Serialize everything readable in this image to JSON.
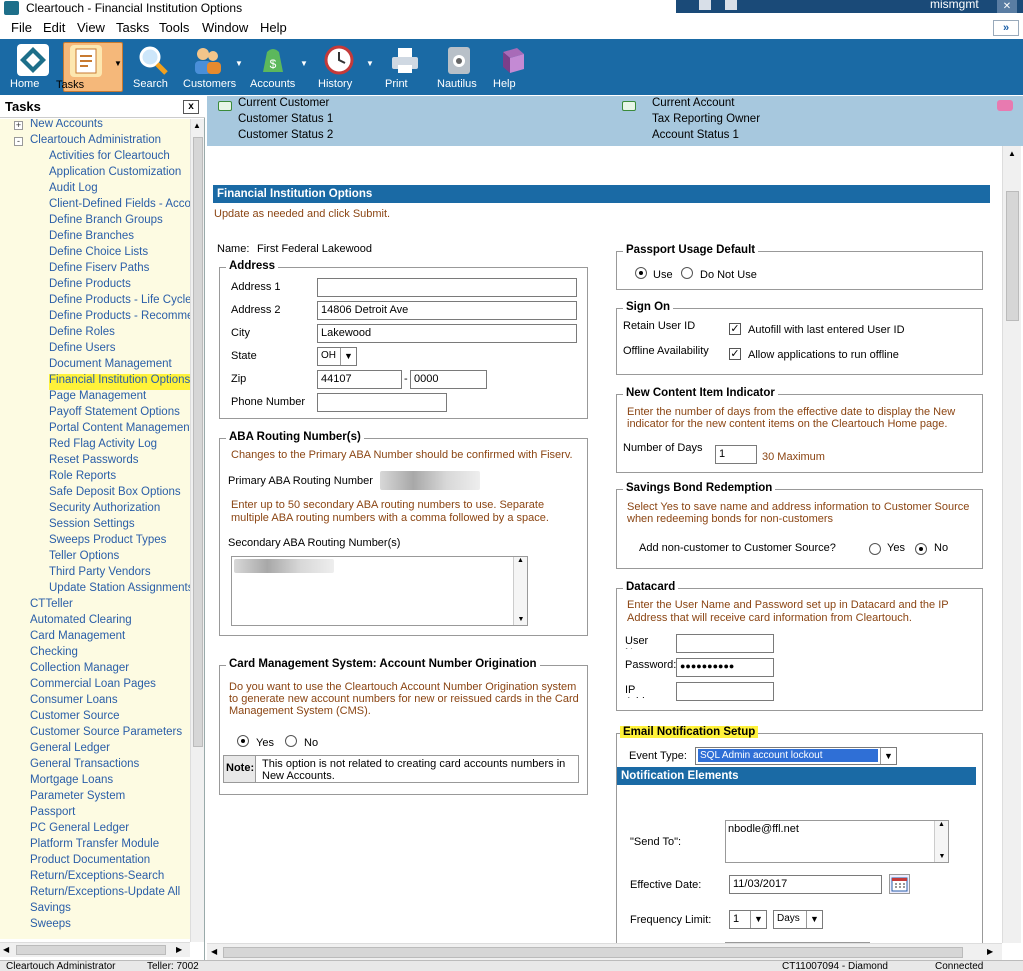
{
  "window": {
    "title": "Cleartouch - Financial Institution Options",
    "user": "mismgmt"
  },
  "menu": [
    "File",
    "Edit",
    "View",
    "Tasks",
    "Tools",
    "Window",
    "Help"
  ],
  "menu_chevron": "»",
  "toolbar": [
    {
      "label": "Home",
      "icon": "home-icon",
      "active": false
    },
    {
      "label": "Tasks",
      "icon": "tasks-icon",
      "active": true
    },
    {
      "label": "Search",
      "icon": "search-icon",
      "active": false
    },
    {
      "label": "Customers",
      "icon": "customers-icon",
      "active": false
    },
    {
      "label": "Accounts",
      "icon": "accounts-icon",
      "active": false
    },
    {
      "label": "History",
      "icon": "history-icon",
      "active": false
    },
    {
      "label": "Print",
      "icon": "print-icon",
      "active": false
    },
    {
      "label": "Nautilus",
      "icon": "nautilus-icon",
      "active": false
    },
    {
      "label": "Help",
      "icon": "help-icon",
      "active": false
    }
  ],
  "tasks_panel": {
    "title": "Tasks",
    "close": "x",
    "items": [
      {
        "label": "New Accounts",
        "level": 0,
        "toggle": "+"
      },
      {
        "label": "Cleartouch Administration",
        "level": 0,
        "toggle": "-"
      },
      {
        "label": "Activities for Cleartouch",
        "level": 1
      },
      {
        "label": "Application Customization",
        "level": 1
      },
      {
        "label": "Audit Log",
        "level": 1
      },
      {
        "label": "Client-Defined Fields - Accou",
        "level": 1
      },
      {
        "label": "Define Branch Groups",
        "level": 1
      },
      {
        "label": "Define Branches",
        "level": 1
      },
      {
        "label": "Define Choice Lists",
        "level": 1
      },
      {
        "label": "Define Fiserv Paths",
        "level": 1
      },
      {
        "label": "Define Products",
        "level": 1
      },
      {
        "label": "Define Products - Life Cycle",
        "level": 1
      },
      {
        "label": "Define Products - Recommer",
        "level": 1
      },
      {
        "label": "Define Roles",
        "level": 1
      },
      {
        "label": "Define Users",
        "level": 1
      },
      {
        "label": "Document Management",
        "level": 1
      },
      {
        "label": "Financial Institution Options",
        "level": 1,
        "selected": true
      },
      {
        "label": "Page Management",
        "level": 1
      },
      {
        "label": "Payoff Statement Options",
        "level": 1
      },
      {
        "label": "Portal Content Management",
        "level": 1
      },
      {
        "label": "Red Flag Activity Log",
        "level": 1
      },
      {
        "label": "Reset Passwords",
        "level": 1
      },
      {
        "label": "Role Reports",
        "level": 1
      },
      {
        "label": "Safe Deposit Box Options",
        "level": 1
      },
      {
        "label": "Security Authorization",
        "level": 1
      },
      {
        "label": "Session Settings",
        "level": 1
      },
      {
        "label": "Sweeps Product Types",
        "level": 1
      },
      {
        "label": "Teller Options",
        "level": 1
      },
      {
        "label": "Third Party Vendors",
        "level": 1
      },
      {
        "label": "Update Station Assignments",
        "level": 1
      },
      {
        "label": "CTTeller",
        "level": 0
      },
      {
        "label": "Automated Clearing",
        "level": 0
      },
      {
        "label": "Card Management",
        "level": 0
      },
      {
        "label": "Checking",
        "level": 0
      },
      {
        "label": "Collection Manager",
        "level": 0
      },
      {
        "label": "Commercial Loan Pages",
        "level": 0
      },
      {
        "label": "Consumer Loans",
        "level": 0
      },
      {
        "label": "Customer Source",
        "level": 0
      },
      {
        "label": "Customer Source Parameters",
        "level": 0
      },
      {
        "label": "General Ledger",
        "level": 0
      },
      {
        "label": "General Transactions",
        "level": 0
      },
      {
        "label": "Mortgage Loans",
        "level": 0
      },
      {
        "label": "Parameter System",
        "level": 0
      },
      {
        "label": "Passport",
        "level": 0
      },
      {
        "label": "PC General Ledger",
        "level": 0
      },
      {
        "label": "Platform Transfer Module",
        "level": 0
      },
      {
        "label": "Product Documentation",
        "level": 0
      },
      {
        "label": "Return/Exceptions-Search",
        "level": 0
      },
      {
        "label": "Return/Exceptions-Update All",
        "level": 0
      },
      {
        "label": "Savings",
        "level": 0
      },
      {
        "label": "Sweeps",
        "level": 0
      }
    ]
  },
  "customer_bar": {
    "current_customer": "Current Customer",
    "customer_status_1": "Customer Status 1",
    "customer_status_2": "Customer Status 2",
    "current_account": "Current Account",
    "tax_reporting_owner": "Tax Reporting Owner",
    "account_status_1": "Account Status 1"
  },
  "page": {
    "title": "Financial Institution Options",
    "instructions": "Update as needed and click Submit.",
    "name_label": "Name:",
    "name_value": "First Federal Lakewood"
  },
  "address": {
    "legend": "Address",
    "address1_label": "Address 1",
    "address1_value": "",
    "address2_label": "Address 2",
    "address2_value": "14806 Detroit Ave",
    "city_label": "City",
    "city_value": "Lakewood",
    "state_label": "State",
    "state_value": "OH",
    "zip_label": "Zip",
    "zip_value": "44107",
    "zip_sep": "-",
    "zip4_value": "0000",
    "phone_label": "Phone Number",
    "phone_value": ""
  },
  "aba": {
    "legend": "ABA Routing Number(s)",
    "note1": "Changes to the Primary ABA Number should be confirmed with Fiserv.",
    "primary_label": "Primary ABA Routing Number",
    "note2": "Enter up to 50 secondary ABA routing numbers to use. Separate multiple ABA routing numbers with a comma followed by a space.",
    "secondary_label": "Secondary ABA Routing Number(s)"
  },
  "cms": {
    "legend": "Card Management System: Account Number Origination",
    "question": "Do you want to use the Cleartouch Account Number Origination system to generate new account numbers for new or reissued cards in the Card Management System (CMS).",
    "yes": "Yes",
    "no": "No",
    "selected": "Yes",
    "note_label": "Note:",
    "note_text": "This option is not related to creating card accounts numbers in New Accounts."
  },
  "passport": {
    "legend": "Passport Usage Default",
    "use": "Use",
    "do_not_use": "Do Not Use",
    "selected": "Use"
  },
  "sign_on": {
    "legend": "Sign On",
    "retain_label": "Retain User ID",
    "retain_text": "Autofill with last entered User ID",
    "retain_checked": true,
    "offline_label": "Offline Availability",
    "offline_text": "Allow applications to run offline",
    "offline_checked": true
  },
  "new_content": {
    "legend": "New Content Item Indicator",
    "description": "Enter the number of days from the effective date to display the New indicator for the new content items on the Cleartouch Home page.",
    "days_label": "Number of Days",
    "days_value": "1",
    "max_text": "30 Maximum"
  },
  "savings_bond": {
    "legend": "Savings Bond Redemption",
    "description": "Select Yes to save name and address information to Customer Source when redeeming bonds for non-customers",
    "question": "Add non-customer to Customer Source?",
    "yes": "Yes",
    "no": "No",
    "selected": "No"
  },
  "datacard": {
    "legend": "Datacard",
    "description": "Enter the User Name and Password set up in Datacard and the IP Address that will receive card information from Cleartouch.",
    "user_label": "User Name",
    "user_value": "",
    "password_label": "Password:",
    "password_value": "●●●●●●●●●●",
    "ip_label": "IP Address",
    "ip_value": ""
  },
  "email_setup": {
    "legend": "Email Notification Setup",
    "event_label": "Event Type:",
    "event_value": "SQL Admin account lockout",
    "elements_title": "Notification Elements",
    "send_to_label": "\"Send To\":",
    "send_to_value": "nbodle@ffl.net",
    "effective_label": "Effective Date:",
    "effective_value": "11/03/2017",
    "frequency_label": "Frequency Limit:",
    "frequency_value": "1",
    "frequency_unit": "Days"
  },
  "statusbar": {
    "user": "Cleartouch Administrator",
    "teller": "Teller: 7002",
    "station": "CT11007094 - Diamond",
    "connection": "Connected"
  },
  "colors": {
    "toolbar_bg": "#1a6aa5",
    "custbar_bg": "#a7c8de",
    "tree_bg": "#fdfbe2",
    "highlight": "#fff23a",
    "link": "#2a5ea8",
    "note_text": "#8b4513"
  }
}
